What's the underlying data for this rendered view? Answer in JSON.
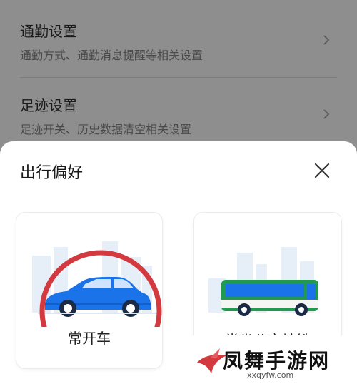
{
  "settings": {
    "items": [
      {
        "title": "通勤设置",
        "desc": "通勤方式、通勤消息提醒等相关设置"
      },
      {
        "title": "足迹设置",
        "desc": "足迹开关、历史数据清空相关设置"
      }
    ]
  },
  "sheet": {
    "title": "出行偏好",
    "options": [
      {
        "label": "常开车",
        "icon": "car-icon"
      },
      {
        "label": "常坐公交地铁",
        "icon": "bus-icon"
      }
    ]
  },
  "watermark": {
    "text": "凤舞手游网",
    "url": "xxqyfw.com"
  },
  "colors": {
    "overlay": "#8e8e8e",
    "highlight_circle": "#d33a3f",
    "car_blue": "#1a73e8",
    "bus_green": "#1f9a4f"
  }
}
